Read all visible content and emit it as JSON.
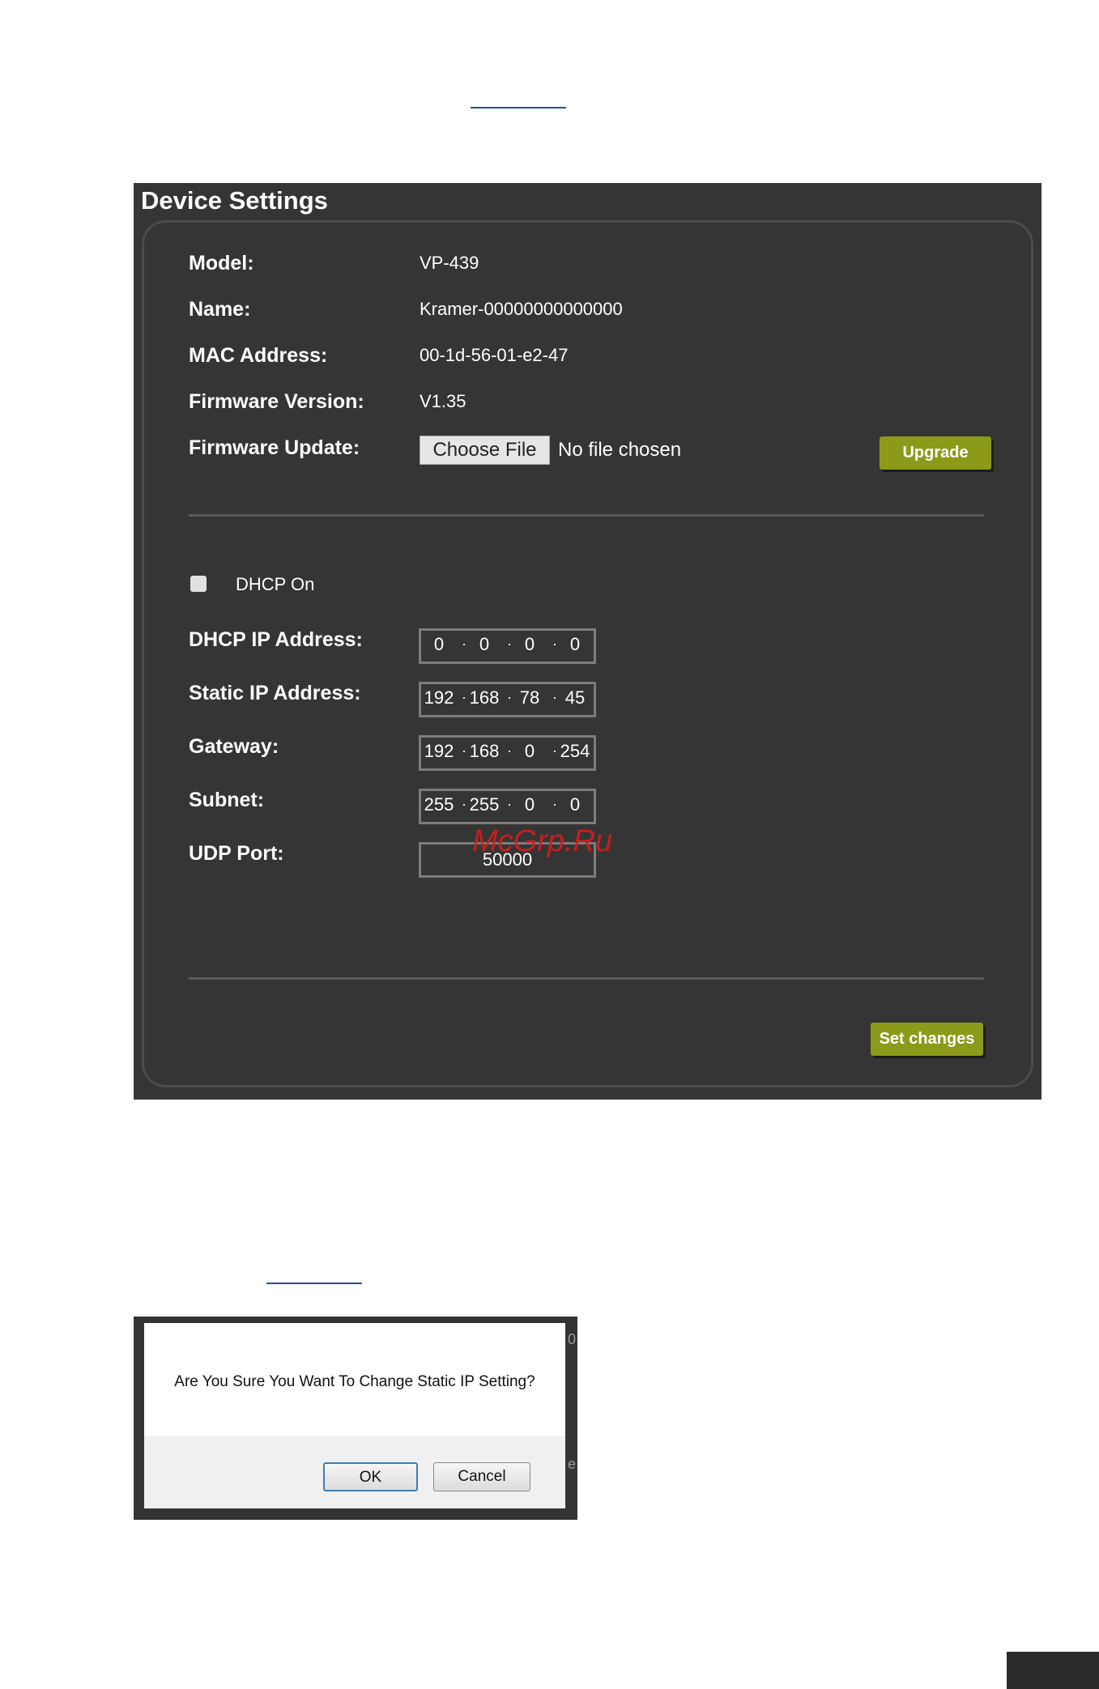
{
  "device_settings": {
    "title": "Device Settings",
    "model_label": "Model:",
    "model_value": "VP-439",
    "name_label": "Name:",
    "name_value": "Kramer-00000000000000",
    "mac_label": "MAC Address:",
    "mac_value": "00-1d-56-01-e2-47",
    "firmware_version_label": "Firmware Version:",
    "firmware_version_value": "V1.35",
    "firmware_update_label": "Firmware Update:",
    "choose_file_label": "Choose File",
    "no_file_text": "No file chosen",
    "upgrade_label": "Upgrade",
    "dhcp_on_label": "DHCP On",
    "dhcp_checked": false,
    "dhcp_ip_label": "DHCP IP Address:",
    "dhcp_ip": [
      "0",
      "0",
      "0",
      "0"
    ],
    "static_ip_label": "Static IP Address:",
    "static_ip": [
      "192",
      "168",
      "78",
      "45"
    ],
    "gateway_label": "Gateway:",
    "gateway": [
      "192",
      "168",
      "0",
      "254"
    ],
    "subnet_label": "Subnet:",
    "subnet": [
      "255",
      "255",
      "0",
      "0"
    ],
    "udp_port_label": "UDP Port:",
    "udp_port": "50000",
    "set_changes_label": "Set changes",
    "accent_color": "#8c9a1a"
  },
  "watermark": "McGrp.Ru",
  "confirm_dialog": {
    "message": "Are You Sure You Want To Change Static IP Setting?",
    "ok_label": "OK",
    "cancel_label": "Cancel",
    "side_chars": [
      "0",
      "e"
    ]
  }
}
